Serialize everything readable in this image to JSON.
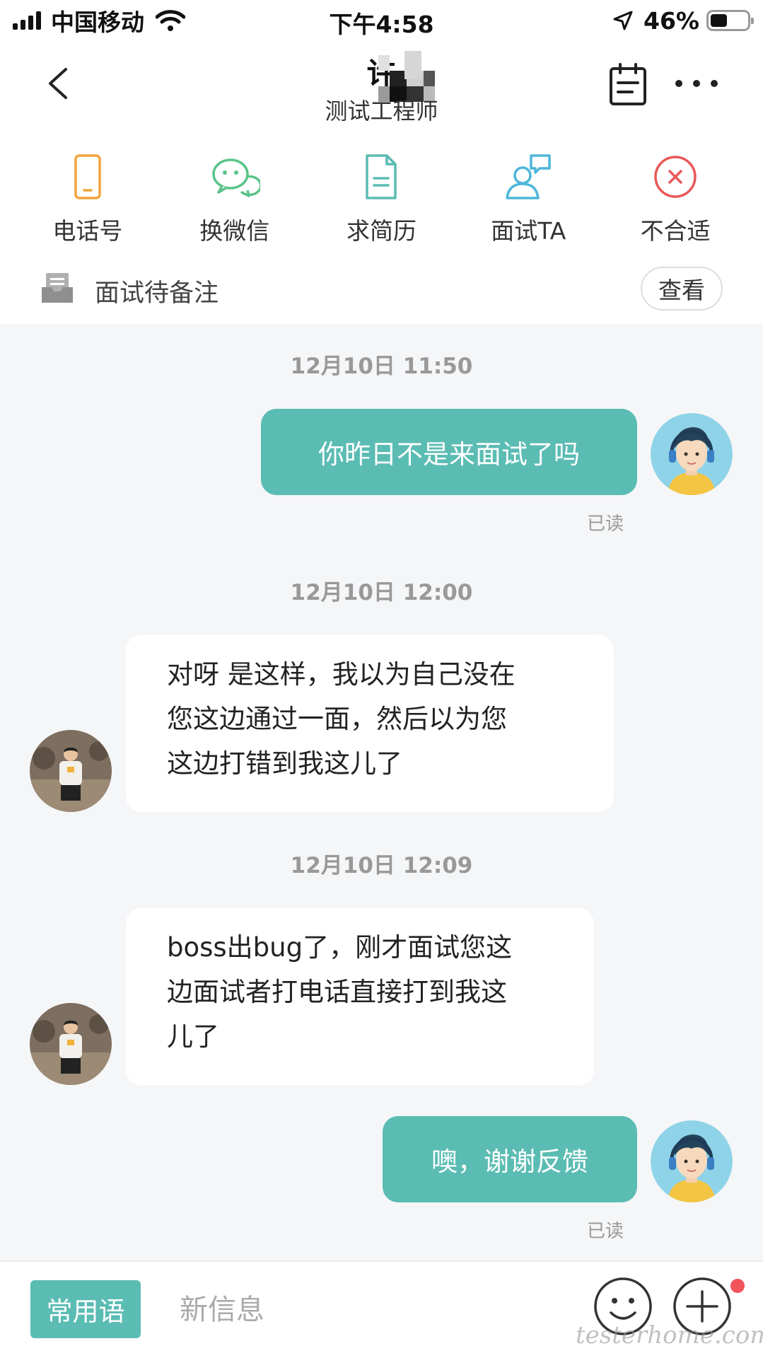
{
  "status_bar": {
    "carrier": "中国移动",
    "time": "下午4:58",
    "battery_percent": "46%",
    "battery_level": 0.46
  },
  "header": {
    "title": "许",
    "subtitle": "测试工程师"
  },
  "actions": [
    {
      "label": "电话号",
      "icon": "phone-icon",
      "color": "#f4a33c"
    },
    {
      "label": "换微信",
      "icon": "wechat-icon",
      "color": "#5bc48a"
    },
    {
      "label": "求简历",
      "icon": "resume-icon",
      "color": "#5bbcb3"
    },
    {
      "label": "面试TA",
      "icon": "interview-icon",
      "color": "#4db6d9"
    },
    {
      "label": "不合适",
      "icon": "reject-icon",
      "color": "#e85858"
    }
  ],
  "memo": {
    "text": "面试待备注",
    "button": "查看"
  },
  "messages": [
    {
      "timestamp": "12月10日 11:50",
      "sender": "me",
      "text": "你昨日不是来面试了吗",
      "status": "已读"
    },
    {
      "timestamp": "12月10日 12:00",
      "sender": "other",
      "lines": [
        "对呀  是这样，我以为自己没在",
        "您这边通过一面，然后以为您",
        "这边打错到我这儿了"
      ]
    },
    {
      "timestamp": "12月10日 12:09",
      "sender": "other",
      "lines": [
        "boss出bug了，刚才面试您这",
        "边面试者打电话直接打到我这",
        "儿了"
      ]
    },
    {
      "sender": "me",
      "text": "噢，谢谢反馈",
      "status": "已读"
    }
  ],
  "input_bar": {
    "phrase_button": "常用语",
    "placeholder": "新信息",
    "watermark": "testerhome.com"
  },
  "colors": {
    "accent": "#5bbcb3",
    "background": "#f5f6f8",
    "badge": "#f2545b"
  }
}
